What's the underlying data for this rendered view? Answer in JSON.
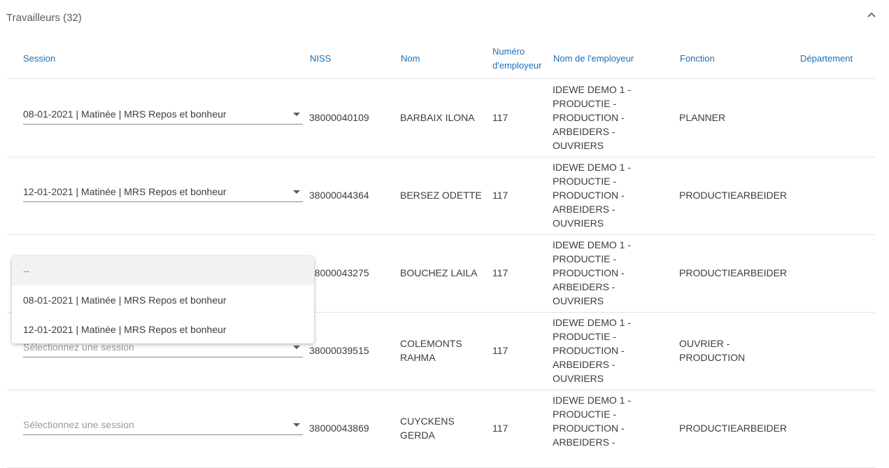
{
  "panel": {
    "title": "Travailleurs (32)"
  },
  "table": {
    "headers": {
      "session": "Session",
      "niss": "NISS",
      "nom": "Nom",
      "numero_line1": "Numéro",
      "numero_line2": "d'employeur",
      "employeur": "Nom de l'employeur",
      "fonction": "Fonction",
      "departement": "Département"
    },
    "rows": [
      {
        "session": "08-01-2021 | Matinée | MRS Repos et bonheur",
        "niss": "38000040109",
        "nom": [
          "BARBAIX ILONA"
        ],
        "numero": "117",
        "employeur": [
          "IDEWE DEMO 1 -",
          "PRODUCTIE -",
          "PRODUCTION -",
          "ARBEIDERS -",
          "OUVRIERS"
        ],
        "fonction": [
          "PLANNER"
        ],
        "departement": ""
      },
      {
        "session": "12-01-2021 | Matinée | MRS Repos et bonheur",
        "niss": "38000044364",
        "nom": [
          "BERSEZ ODETTE"
        ],
        "numero": "117",
        "employeur": [
          "IDEWE DEMO 1 -",
          "PRODUCTIE -",
          "PRODUCTION -",
          "ARBEIDERS -",
          "OUVRIERS"
        ],
        "fonction": [
          "PRODUCTIEARBEIDER"
        ],
        "departement": ""
      },
      {
        "session": "",
        "niss": "38000043275",
        "nom": [
          "BOUCHEZ LAILA"
        ],
        "numero": "117",
        "employeur": [
          "IDEWE DEMO 1 -",
          "PRODUCTIE -",
          "PRODUCTION -",
          "ARBEIDERS -",
          "OUVRIERS"
        ],
        "fonction": [
          "PRODUCTIEARBEIDER"
        ],
        "departement": ""
      },
      {
        "session": "Sélectionnez une session",
        "niss": "38000039515",
        "nom": [
          "COLEMONTS",
          "RAHMA"
        ],
        "numero": "117",
        "employeur": [
          "IDEWE DEMO 1 -",
          "PRODUCTIE -",
          "PRODUCTION -",
          "ARBEIDERS -",
          "OUVRIERS"
        ],
        "fonction": [
          "OUVRIER -",
          "PRODUCTION"
        ],
        "departement": ""
      },
      {
        "session": "Sélectionnez une session",
        "niss": "38000043869",
        "nom": [
          "CUYCKENS",
          "GERDA"
        ],
        "numero": "117",
        "employeur": [
          "IDEWE DEMO 1 -",
          "PRODUCTIE -",
          "PRODUCTION -",
          "ARBEIDERS -"
        ],
        "fonction": [
          "PRODUCTIEARBEIDER"
        ],
        "departement": ""
      }
    ]
  },
  "dropdown": {
    "options": [
      "--",
      "08-01-2021 | Matinée | MRS Repos et bonheur",
      "12-01-2021 | Matinée | MRS Repos et bonheur"
    ]
  },
  "icons": {
    "collapse": "chevron-up-icon",
    "select_caret": "caret-down-icon"
  },
  "colors": {
    "header_text": "#1c6fb4",
    "body_text": "#3c3c3c",
    "divider": "#e4e4e4"
  }
}
